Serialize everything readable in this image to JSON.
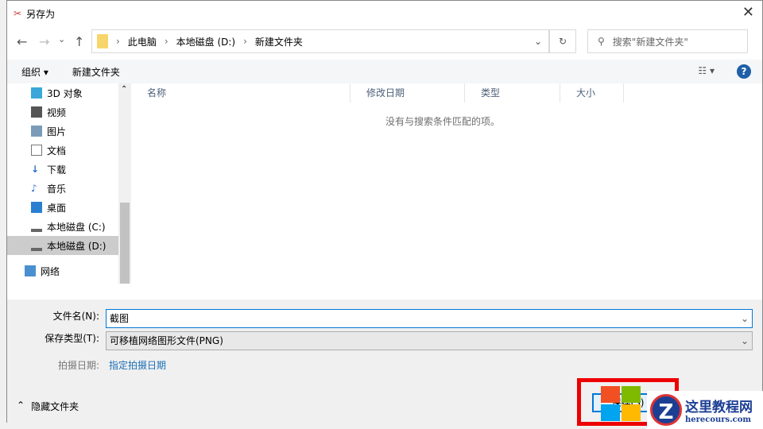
{
  "window": {
    "title": "另存为",
    "close": "✕"
  },
  "nav": {
    "back": "←",
    "forward": "→",
    "recent": "⌄",
    "up": "↑",
    "path": [
      "此电脑",
      "本地磁盘 (D:)",
      "新建文件夹"
    ],
    "refresh": "↻",
    "search_placeholder": "搜索\"新建文件夹\""
  },
  "toolbar": {
    "organize": "组织 ▾",
    "new_folder": "新建文件夹",
    "view": "☷ ▾",
    "help": "?"
  },
  "sidebar": {
    "items": [
      "3D 对象",
      "视频",
      "图片",
      "文档",
      "下载",
      "音乐",
      "桌面",
      "本地磁盘 (C:)",
      "本地磁盘 (D:)",
      "网络"
    ]
  },
  "list": {
    "columns": [
      "名称",
      "修改日期",
      "类型",
      "大小"
    ],
    "empty": "没有与搜索条件匹配的项。"
  },
  "form": {
    "filename_label": "文件名(N):",
    "filename": "截图",
    "type_label": "保存类型(T):",
    "type": "可移植网络图形文件(PNG)",
    "date_label": "拍摄日期:",
    "date_link": "指定拍摄日期"
  },
  "footer": {
    "hide_folders": "隐藏文件夹",
    "save": "保存(S)"
  },
  "watermark": {
    "name": "这里教程网",
    "url": "herecours.com"
  }
}
